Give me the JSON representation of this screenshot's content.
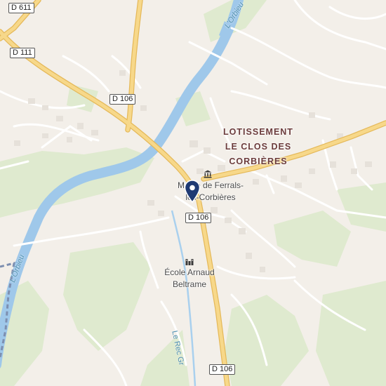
{
  "map": {
    "roads": [
      {
        "ref": "D 611"
      },
      {
        "ref": "D 111"
      },
      {
        "ref": "D 106"
      },
      {
        "ref": "D 106"
      },
      {
        "ref": "D 106"
      }
    ],
    "places": {
      "district": [
        "LOTISSEMENT",
        "LE CLOS DES",
        "CORBIÈRES"
      ],
      "town_hall": [
        "Mairie de Ferrals-",
        "les-Corbières"
      ],
      "school": [
        "École Arnaud",
        "Beltrame"
      ]
    },
    "waterways": {
      "river_upper": "L'Orbieu",
      "river_lower": "L'Orbieu",
      "stream": "Le Rec Gr"
    },
    "colors": {
      "land": "#f3efe9",
      "green": "#dfeacf",
      "water": "#9fc8ea",
      "primary_road": "#f2cc6e",
      "minor_road": "#ffffff",
      "pin": "#1f3a73"
    },
    "icons": [
      "map-pin-icon",
      "town-hall-icon",
      "school-icon"
    ]
  }
}
